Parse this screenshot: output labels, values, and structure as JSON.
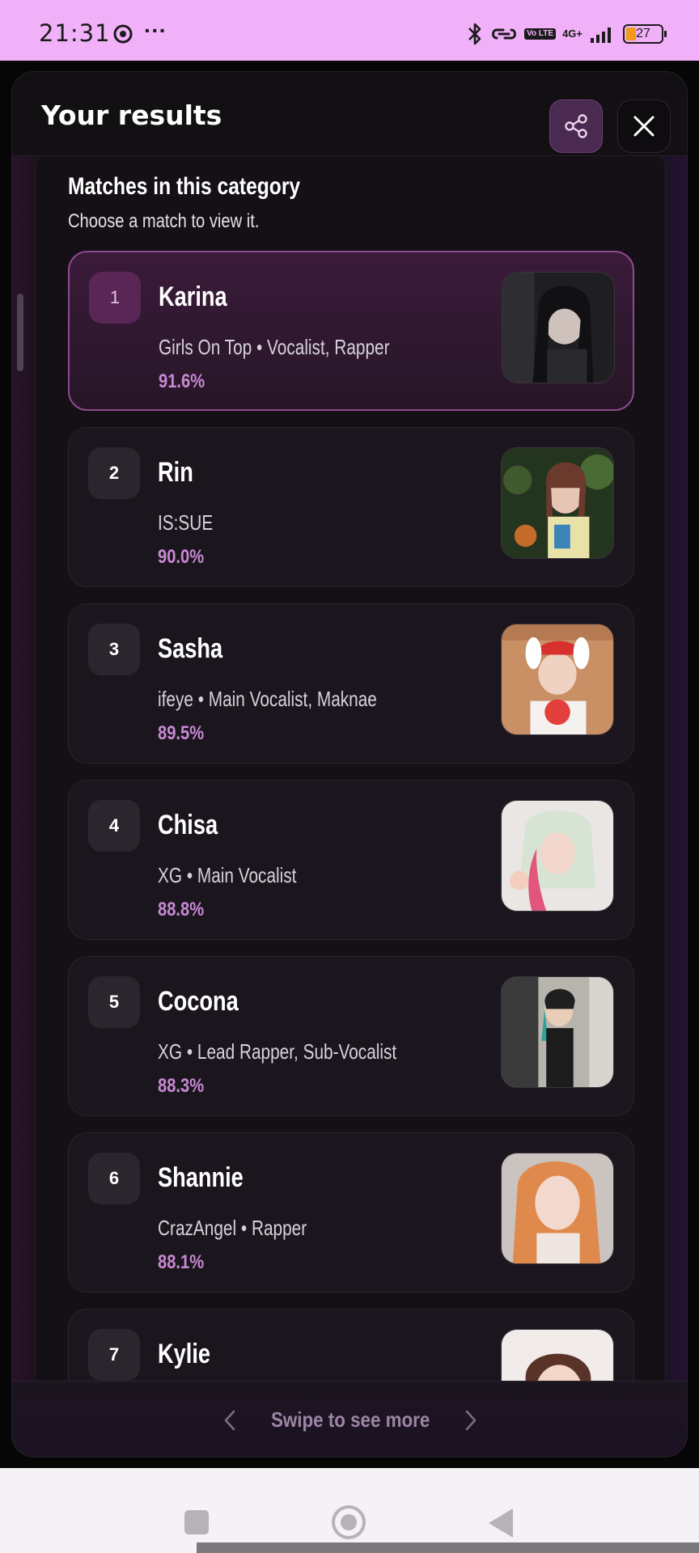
{
  "status_bar": {
    "time": "21:31",
    "dots": "···",
    "volte": "Vo LTE",
    "network": "4G+",
    "battery": "27"
  },
  "header": {
    "title": "Your results",
    "share_icon": "share-icon",
    "close_icon": "close-icon"
  },
  "panel": {
    "title": "Matches in this category",
    "subtitle": "Choose a match to view it."
  },
  "matches": [
    {
      "rank": "1",
      "name": "Karina",
      "meta": "Girls On Top • Vocalist, Rapper",
      "score": "91.6%",
      "selected": true
    },
    {
      "rank": "2",
      "name": "Rin",
      "meta": "IS:SUE",
      "score": "90.0%"
    },
    {
      "rank": "3",
      "name": "Sasha",
      "meta": "ifeye • Main Vocalist, Maknae",
      "score": "89.5%"
    },
    {
      "rank": "4",
      "name": "Chisa",
      "meta": "XG • Main Vocalist",
      "score": "88.8%"
    },
    {
      "rank": "5",
      "name": "Cocona",
      "meta": "XG • Lead Rapper, Sub-Vocalist",
      "score": "88.3%"
    },
    {
      "rank": "6",
      "name": "Shannie",
      "meta": "CrazAngel • Rapper",
      "score": "88.1%"
    },
    {
      "rank": "7",
      "name": "Kylie",
      "meta": "",
      "score": ""
    }
  ],
  "footer": {
    "label": "Swipe to see more"
  },
  "colors": {
    "status_bar": "#f1b1f8",
    "accent": "#c889d4",
    "selected_border": "#8d4a8e"
  }
}
